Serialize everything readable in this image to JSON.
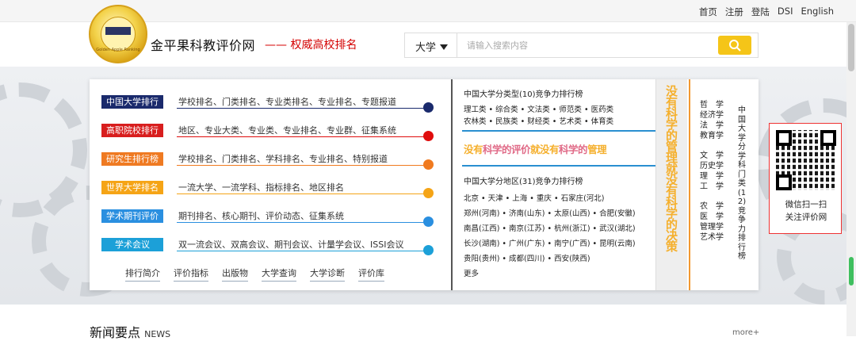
{
  "topbar": {
    "links": [
      "首页",
      "注册",
      "登陆",
      "DSI",
      "English"
    ]
  },
  "header": {
    "site_title": "金平果科教评价网",
    "slogan": "—— 权威高校排名",
    "logo_text": "Golden Apple Ranking"
  },
  "search": {
    "category": "大学",
    "placeholder": "请输入搜索内容"
  },
  "categories": [
    {
      "label": "中国大学排行",
      "color": "#1a2a6c",
      "dot": "#1a2a6c",
      "links": "学校排名、门类排名、专业类排名、专业排名、专题报道"
    },
    {
      "label": "高职院校排行",
      "color": "#d81e1e",
      "dot": "#e00d0d",
      "links": "地区、专业大类、专业类、专业排名、专业群、征集系统"
    },
    {
      "label": "研究生排行榜",
      "color": "#ef7a22",
      "dot": "#f07a1f",
      "links": "学校排名、门类排名、学科排名、专业排名、特别报道"
    },
    {
      "label": "世界大学排名",
      "color": "#f5a416",
      "dot": "#f5a416",
      "links": "一流大学、一流学科、指标排名、地区排名"
    },
    {
      "label": "学术期刊评价",
      "color": "#2a8fe0",
      "dot": "#2a8fe0",
      "links": "期刊排名、核心期刊、评价动态、征集系统"
    },
    {
      "label": "学术会议",
      "color": "#1ca0d8",
      "dot": "#1ca0d8",
      "links": "双一流会议、双高会议、期刊会议、计量学会议、ISSI会议"
    }
  ],
  "bottom_nav": [
    "排行简介",
    "评价指标",
    "出版物",
    "大学查询",
    "大学诊断",
    "评价库"
  ],
  "type_ranking": {
    "title": "中国大学分类型(10)竞争力排行榜",
    "row1": "理工类 • 综合类 • 文法类 • 师范类 • 医药类",
    "row2": "农林类 • 民族类 • 财经类 • 艺术类 • 体育类"
  },
  "banner": {
    "part1": "没有",
    "part2": "科学的评价",
    "part3": "就没有",
    "part4": "科学的",
    "part5": "管理"
  },
  "region_ranking": {
    "title": "中国大学分地区(31)竞争力排行榜",
    "rows": [
      "北京 • 天津 • 上海 • 重庆 • 石家庄(河北)",
      "郑州(河南) • 济南(山东) • 太原(山西) • 合肥(安徽)",
      "南昌(江西) • 南京(江苏) • 杭州(浙江) • 武汉(湖北)",
      "长沙(湖南) • 广州(广东) • 南宁(广西) • 昆明(云南)",
      "贵阳(贵州) • 成都(四川) • 西安(陕西)",
      "更多"
    ]
  },
  "vertical_banner": "没有科学的管理就没有科学的决策",
  "subjects": [
    "哲　学",
    "经济学",
    "法　学",
    "教育学",
    "文　学",
    "历史学",
    "理　学",
    "工　学",
    "农　学",
    "医　学",
    "管理学",
    "艺术学"
  ],
  "subject_ranking_title": "中国大学分学科门类(12)竞争力排行榜",
  "qr": {
    "line1": "微信扫一扫",
    "line2": "关注评价网"
  },
  "news": {
    "title": "新闻要点",
    "en": "NEWS",
    "more": "more+"
  },
  "colors": {
    "accent": "#f5c518",
    "brand_red": "#d40000",
    "divider_orange": "#f29830",
    "divider_blue": "#2a8fd0"
  }
}
